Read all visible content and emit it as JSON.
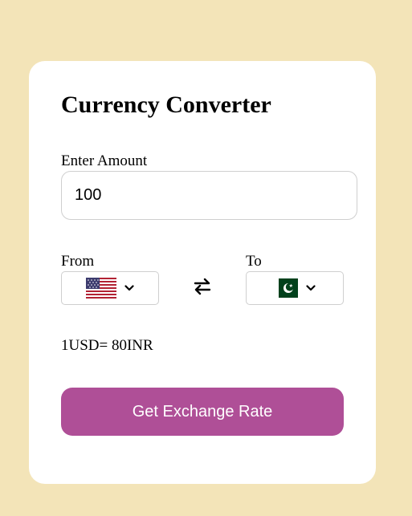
{
  "app": {
    "title": "Currency Converter"
  },
  "amount": {
    "label": "Enter Amount",
    "value": "100"
  },
  "from": {
    "label": "From",
    "flag_icon": "us-flag-icon"
  },
  "to": {
    "label": "To",
    "flag_icon": "pakistan-flag-icon"
  },
  "swap_icon": "swap-arrows-icon",
  "exchange_rate_text": "1USD= 80INR",
  "button": {
    "label": "Get Exchange Rate"
  },
  "colors": {
    "page_background": "#f3e4b8",
    "card_background": "#ffffff",
    "button_background": "#af4f97",
    "button_text": "#ffffff"
  }
}
